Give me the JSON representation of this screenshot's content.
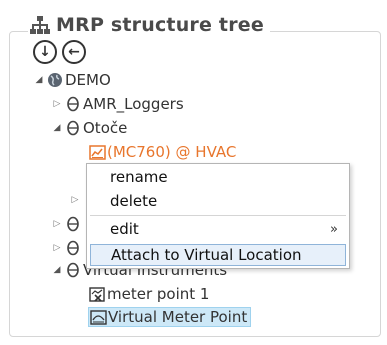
{
  "panel": {
    "title": "MRP structure tree",
    "expand_all_icon": "arrow-down-circle-icon",
    "back_icon": "arrow-left-circle-icon"
  },
  "tree": {
    "root": {
      "label": "DEMO",
      "expanded": true
    },
    "nodes": [
      {
        "label": "AMR_Loggers",
        "expanded": false
      },
      {
        "label": "Otoče",
        "expanded": true
      },
      {
        "label": "(MC760) @ HVAC",
        "color": "#e8762d"
      },
      {
        "label": "Virtual Instruments",
        "expanded": true
      },
      {
        "label": "meter point 1"
      },
      {
        "label": "Virtual Meter Point",
        "selected": true
      }
    ]
  },
  "context_menu": {
    "items": [
      {
        "label": "rename"
      },
      {
        "label": "delete"
      },
      {
        "label": "edit",
        "submenu_marker": "»"
      },
      {
        "label": "Attach to Virtual Location",
        "highlighted": true
      }
    ]
  },
  "colors": {
    "accent_orange": "#e8762d",
    "selection_bg": "#cde8f7",
    "menu_highlight_border": "#8fb4d9"
  }
}
